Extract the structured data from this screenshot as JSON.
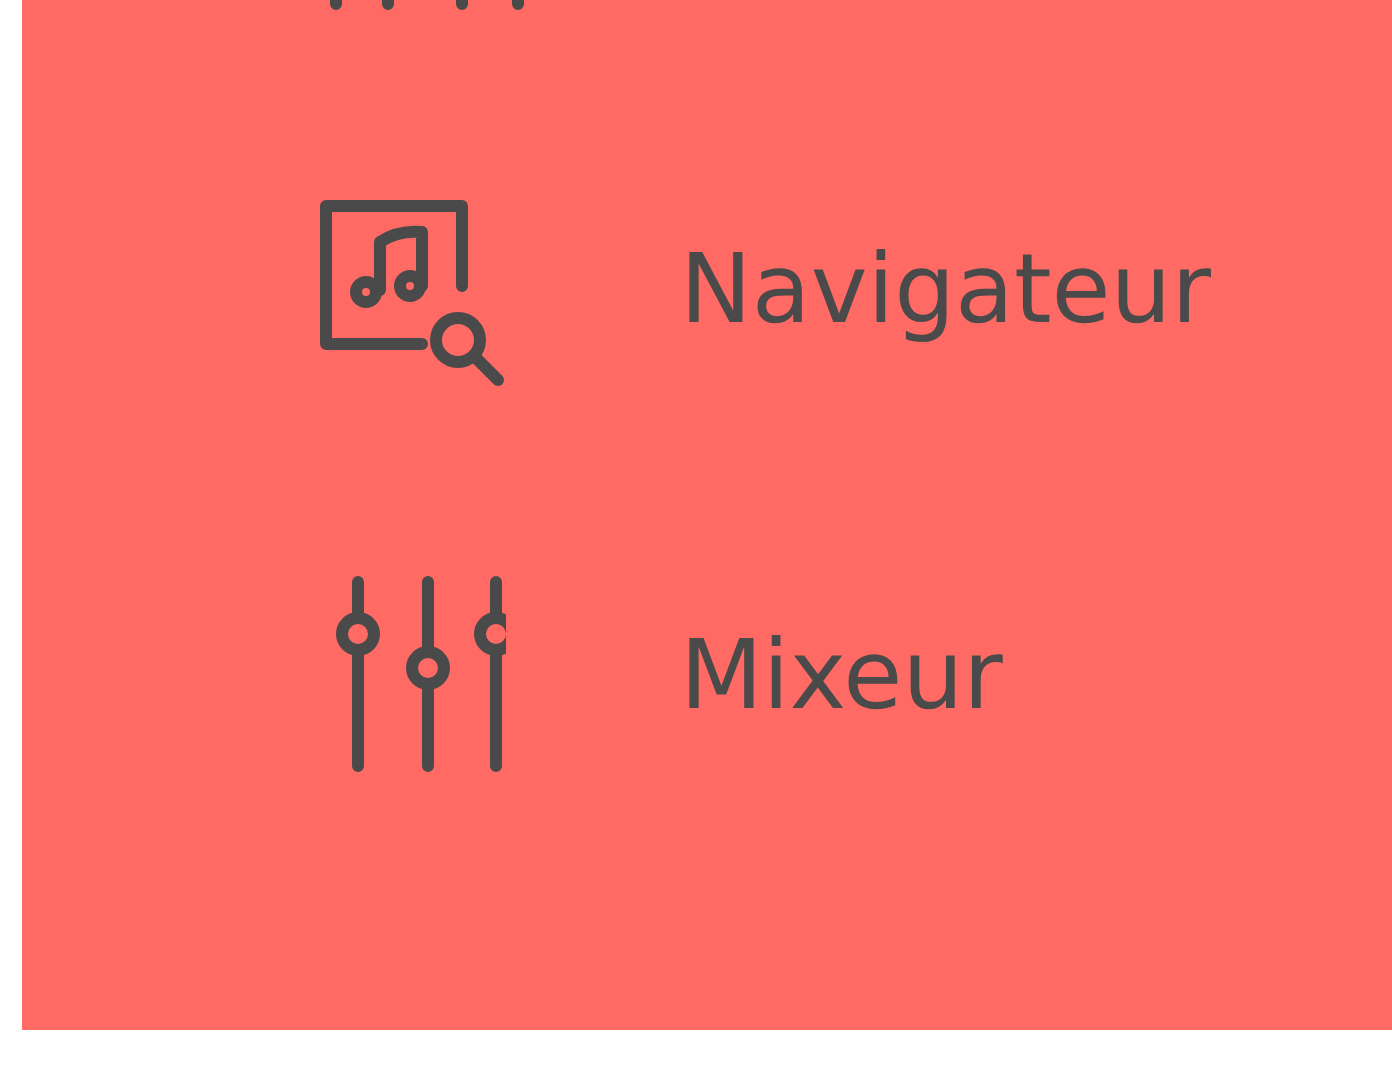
{
  "menu": {
    "items": [
      {
        "label": "Navigateur"
      },
      {
        "label": "Mixeur"
      }
    ]
  }
}
